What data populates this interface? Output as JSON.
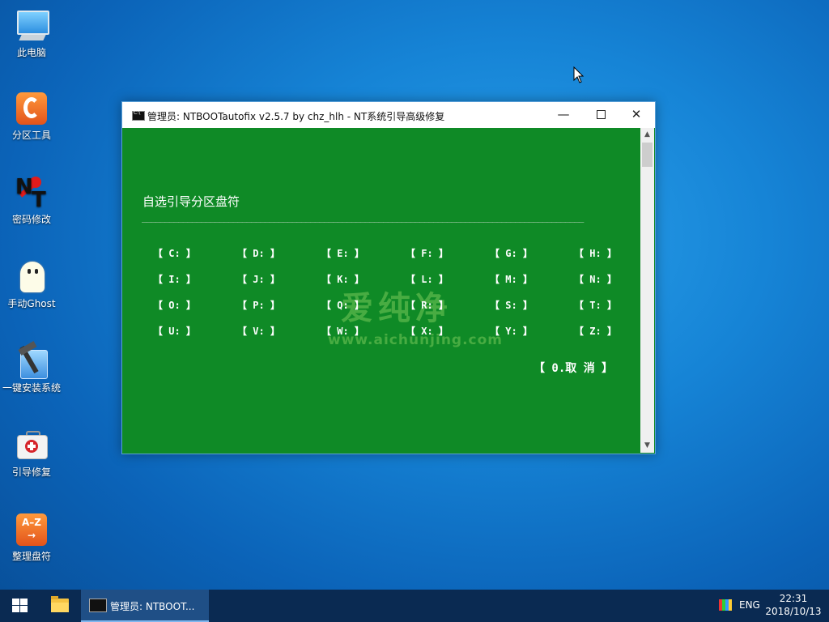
{
  "desktop": {
    "icons": [
      {
        "label": "此电脑",
        "icon": "this-pc-icon"
      },
      {
        "label": "分区工具",
        "icon": "partition-tool-icon"
      },
      {
        "label": "密码修改",
        "icon": "password-reset-icon"
      },
      {
        "label": "手动Ghost",
        "icon": "ghost-icon"
      },
      {
        "label": "一键安装系统",
        "icon": "install-system-icon"
      },
      {
        "label": "引导修复",
        "icon": "boot-repair-icon"
      },
      {
        "label": "整理盘符",
        "icon": "sort-drive-letters-icon"
      }
    ],
    "az_glyph_top": "A–Z",
    "az_glyph_arrow": "→"
  },
  "window": {
    "title": "管理员:  NTBOOTautofix v2.5.7 by chz_hlh - NT系统引导高级修复",
    "controls": {
      "minimize": "—",
      "close": "✕"
    },
    "heading": "自选引导分区盘符",
    "rule": "_________________________________________________________________________________________________",
    "drives": [
      "【 C: 】",
      "【 D: 】",
      "【 E: 】",
      "【 F: 】",
      "【 G: 】",
      "【 H: 】",
      "【 I: 】",
      "【 J: 】",
      "【 K: 】",
      "【 L: 】",
      "【 M: 】",
      "【 N: 】",
      "【 O: 】",
      "【 P: 】",
      "【 Q: 】",
      "【 R: 】",
      "【 S: 】",
      "【 T: 】",
      "【 U: 】",
      "【 V: 】",
      "【 W: 】",
      "【 X: 】",
      "【 Y: 】",
      "【 Z: 】"
    ],
    "cancel": "【 0.取  消 】",
    "watermark": "爱纯净",
    "watermark_url": "www.aichunjing.com",
    "scroll_up": "▲",
    "scroll_down": "▼"
  },
  "taskbar": {
    "task_label": "管理员: NTBOOT...",
    "language": "ENG",
    "time": "22:31",
    "date": "2018/10/13"
  }
}
